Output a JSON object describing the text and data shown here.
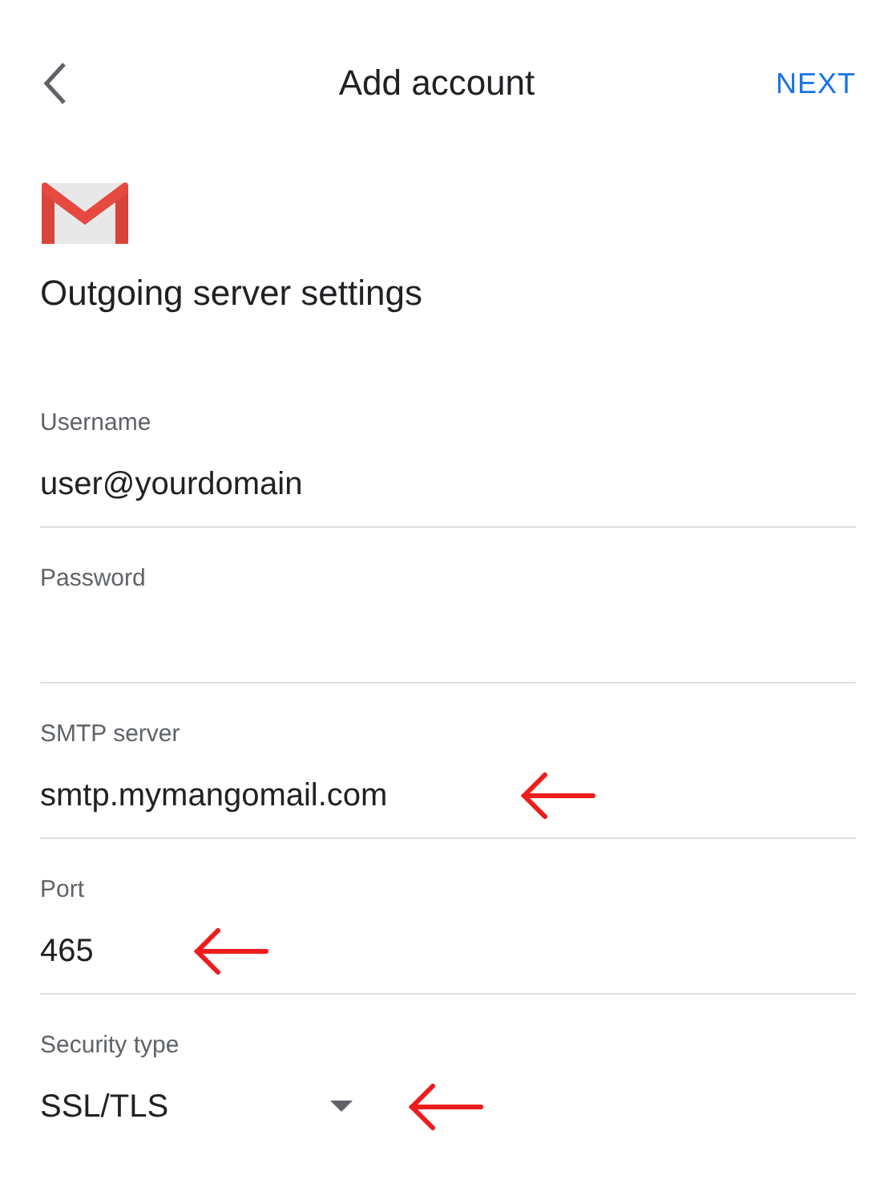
{
  "header": {
    "title": "Add account",
    "action": "NEXT"
  },
  "heading": "Outgoing server settings",
  "fields": [
    {
      "kind": "text",
      "label": "Username",
      "value": "user@yourdomain",
      "annotated": false
    },
    {
      "kind": "password",
      "label": "Password",
      "annotated": false
    },
    {
      "kind": "text",
      "label": "SMTP server",
      "value": "smtp.mymangomail.com",
      "annotated": true
    },
    {
      "kind": "text",
      "label": "Port",
      "value": "465",
      "annotated": true
    },
    {
      "kind": "dropdown",
      "label": "Security type",
      "value": "SSL/TLS",
      "annotated": true
    }
  ]
}
